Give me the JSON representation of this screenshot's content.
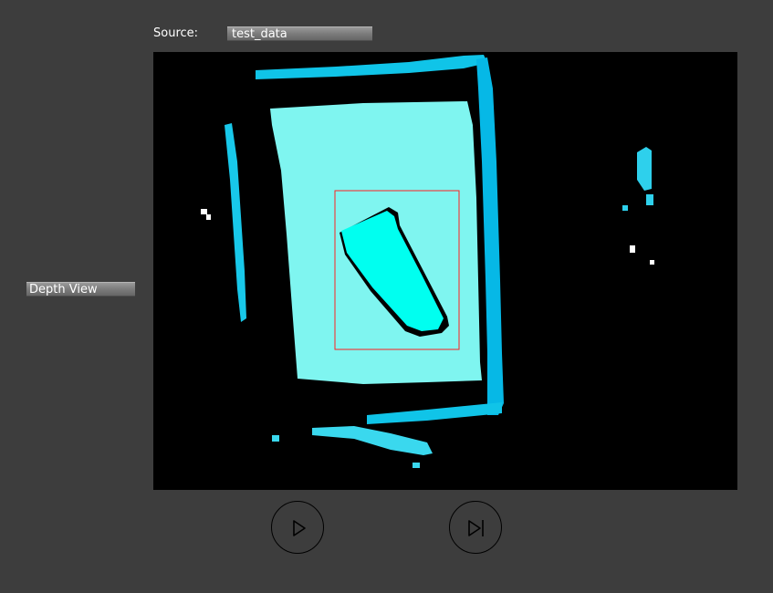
{
  "source": {
    "label": "Source:",
    "value": "test_data"
  },
  "view_mode": {
    "value": "Depth View"
  },
  "depth_view": {
    "colors": {
      "background": "#000000",
      "near": "#00ffff",
      "mid": "#7ff5f0",
      "far": "#10c4e8",
      "edge": "#06b8e6",
      "bbox": "#ff2020"
    }
  },
  "controls": {
    "play_icon": "play-icon",
    "step_icon": "step-forward-icon"
  }
}
